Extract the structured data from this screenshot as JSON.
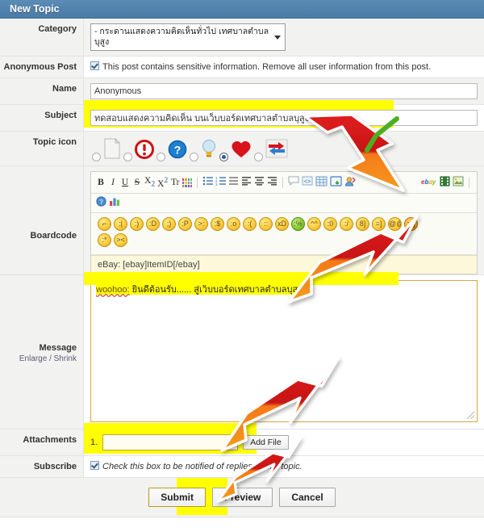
{
  "window": {
    "title": "New Topic"
  },
  "colors": {
    "header_bg": "#4a7ba6",
    "highlight": "#ffff00",
    "arrow_red": "#d42020",
    "arrow_orange": "#f47216",
    "check_green": "#4caf22",
    "message_border": "#d8a93c"
  },
  "form": {
    "category": {
      "label": "Category",
      "value": "- กระดานแสดงความคิดเห็นทั่วไป เทศบาลตำบลบุสูง"
    },
    "anonymous": {
      "label": "Anonymous Post",
      "checkbox_text": "This post contains sensitive information. Remove all user information from this post.",
      "checked": true
    },
    "name": {
      "label": "Name",
      "value": "Anonymous",
      "placeholder": "Anonymous"
    },
    "subject": {
      "label": "Subject",
      "value": "ทดสอบแสดงความคิดเห็น บนเว็บบอร์ดเทศบาลตำบลบุสูง",
      "placeholder": "Subject"
    },
    "topic_icon": {
      "label": "Topic icon",
      "options": [
        {
          "name": "blank-page-icon",
          "selected": false
        },
        {
          "name": "exclamation-icon",
          "selected": false
        },
        {
          "name": "question-icon",
          "selected": false
        },
        {
          "name": "lightbulb-icon",
          "selected": false
        },
        {
          "name": "heart-icon",
          "selected": true
        },
        {
          "name": "exchange-arrows-icon",
          "selected": false
        }
      ]
    },
    "boardcode": {
      "label": "Boardcode",
      "toolbar_row1": [
        {
          "name": "bold-icon",
          "glyph": "B"
        },
        {
          "name": "italic-icon",
          "glyph": "I"
        },
        {
          "name": "underline-icon",
          "glyph": "U"
        },
        {
          "name": "strikethrough-icon",
          "glyph": "S"
        },
        {
          "name": "subscript-icon",
          "glyph": "X₂"
        },
        {
          "name": "superscript-icon",
          "glyph": "X²"
        },
        {
          "name": "font-face-icon",
          "glyph": "Tr"
        },
        {
          "name": "font-color-icon",
          "glyph": ""
        },
        {
          "name": "unordered-list-icon",
          "glyph": ""
        },
        {
          "name": "ordered-list-icon",
          "glyph": ""
        },
        {
          "name": "indent-icon",
          "glyph": ""
        },
        {
          "name": "align-left-icon",
          "glyph": ""
        },
        {
          "name": "align-center-icon",
          "glyph": ""
        },
        {
          "name": "align-right-icon",
          "glyph": ""
        },
        {
          "name": "quote-icon",
          "glyph": ""
        },
        {
          "name": "code-icon",
          "glyph": ""
        },
        {
          "name": "table-icon",
          "glyph": ""
        },
        {
          "name": "insert-image-icon",
          "glyph": ""
        },
        {
          "name": "insert-user-icon",
          "glyph": ""
        },
        {
          "name": "ebay-icon",
          "glyph": ""
        },
        {
          "name": "film-icon",
          "glyph": ""
        },
        {
          "name": "picture-icon",
          "glyph": ""
        }
      ],
      "toolbar_row2": [
        {
          "name": "help-icon",
          "glyph": ""
        },
        {
          "name": "poll-chart-icon",
          "glyph": ""
        }
      ],
      "emoticons_row1": [
        "cool",
        "confused",
        "smile",
        "grin",
        "wink",
        "tongue",
        "angry",
        "blush",
        "shocked",
        "sad",
        "rolleyes",
        "laugh",
        "sick",
        "embarrassed",
        "surprised",
        "undecided",
        "nerd",
        "cheesy",
        "dizzy",
        "evil"
      ],
      "emoticons_row2": [
        "kiss",
        "crossed"
      ],
      "ebay_hint": "eBay: [ebay]ItemID[/ebay]"
    },
    "message": {
      "label": "Message",
      "enlarge_label": "Enlarge",
      "separator": "/",
      "shrink_label": "Shrink",
      "body_prefix": "woohoo:",
      "body_text": " ยินดีต้อนรับ...... สู่เว็บบอร์ดเทศบาลตำบลบุสูง"
    },
    "attachments": {
      "label": "Attachments",
      "index": "1.",
      "value": "",
      "placeholder": "",
      "add_file_label": "Add File"
    },
    "subscribe": {
      "label": "Subscribe",
      "checkbox_text": "Check this box to be notified of replies to this topic.",
      "checked": true
    }
  },
  "buttons": {
    "submit": "Submit",
    "preview": "Preview",
    "cancel": "Cancel"
  },
  "annotations": {
    "arrow1": {
      "name": "arrow-pointing-to-subject"
    },
    "arrow2": {
      "name": "arrow-pointing-to-message-box"
    },
    "arrow3": {
      "name": "arrow-pointing-to-add-file"
    },
    "arrow4": {
      "name": "arrow-pointing-to-submit"
    },
    "check": {
      "name": "green-check-mark"
    }
  }
}
